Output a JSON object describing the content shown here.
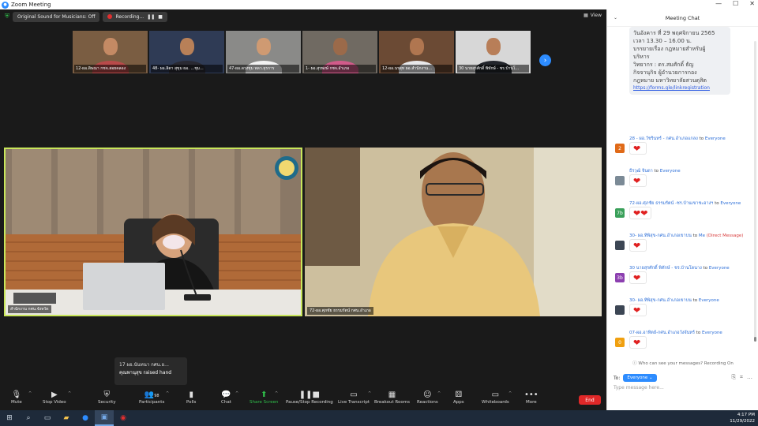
{
  "window": {
    "title": "Zoom Meeting"
  },
  "top_bar": {
    "sound_label": "Original Sound for Musicians: Off",
    "recording_label": "Recording...",
    "view_label": "View"
  },
  "thumbnails": [
    {
      "name": "12-ผอ.ดิษณา กชจ.สอยคลอง",
      "skin": "#c48a64",
      "shirt": "#b84a4a",
      "bg": "#7a5d42"
    },
    {
      "name": "48- ผอ.ลิตา สุขุม ผอ. ...ชุม...",
      "skin": "#b88058",
      "shirt": "#2a2a33",
      "bg": "#2f3b55"
    },
    {
      "name": "47-ผอ.ดวงชุม พลว.ธุรการ",
      "skin": "#cf9a72",
      "shirt": "#f2f2f2",
      "bg": "#8a8a88"
    },
    {
      "name": "1- ผอ.สุรพงษ์ กชจ.อำเภอ",
      "skin": "#9b6a4a",
      "shirt": "#d15b8a",
      "bg": "#706a62"
    },
    {
      "name": "12-ผอ.นรสุท ผอ.สำนักงาน...",
      "skin": "#b07650",
      "shirt": "#e8e8ea",
      "bg": "#6b4a34"
    },
    {
      "name": "30 นายสุรศักดิ์ พิทักษ์ - ชร.บ้านโ...",
      "skin": "#b87e58",
      "shirt": "#23262c",
      "bg": "#d7d7d7"
    }
  ],
  "main_tiles": {
    "left_name": "สำนักงาน กศน.จังหวัด",
    "right_name": "72-ผอ.ศุภชัย ธรรมรัตน์ กศน.อำเภอ"
  },
  "raised_hand": {
    "name": "17 ผอ.นันทนา กศน.อ...",
    "text": "คุณพานุสุข raised hand"
  },
  "toolbar": {
    "mute": "Mute",
    "stop_video": "Stop Video",
    "security": "Security",
    "participants": "Participants",
    "participants_count": "98",
    "polls": "Polls",
    "chat": "Chat",
    "share_screen": "Share Screen",
    "pause_recording": "Pause/Stop Recording",
    "live_transcript": "Live Transcript",
    "breakout_rooms": "Breakout Rooms",
    "reactions": "Reactions",
    "apps": "Apps",
    "whiteboards": "Whiteboards",
    "more": "More",
    "end": "End"
  },
  "chat_panel": {
    "title": "Meeting Chat",
    "pinned_text": [
      "วันอังคาร ที่ 29 พฤศจิกายน 2565",
      "เวลา 13.30 – 16.00 น.",
      "บรรยายเรื่อง กฎหมายสำหรับผู้",
      "บริหาร",
      "วิทยากร : ดร.สมศักดิ์ ธัญ",
      "กิจจานุกิจ ผู้อำนวยการกอง",
      "กฎหมาย มหาวิทยาลัยสวนดุสิต"
    ],
    "pinned_link": "https://forms.gle/linkregistration",
    "messages": [
      {
        "sender": "28 - ผอ.วัชรินทร์ - กศน.อำเภอแกลง",
        "to": "to",
        "recipient": "Everyone",
        "direct": false,
        "avatar_label": "2",
        "avatar_color": "#e06a18",
        "reaction": "❤"
      },
      {
        "sender": "ธีรวุฒิ จินดา",
        "to": "to",
        "recipient": "Everyone",
        "direct": false,
        "avatar_label": "",
        "avatar_color": "#7b8a96",
        "reaction": "❤"
      },
      {
        "sender": "72-ผอ.ศุภชัย ธรรมรัตน์ -ชร.บ้านเขาชะอางฯ",
        "to": "to",
        "recipient": "Everyone",
        "direct": false,
        "avatar_label": "7b",
        "avatar_color": "#3aa05a",
        "reaction": "❤❤"
      },
      {
        "sender": "30- ผอ.ทิพิสุข-กศน.อำเภอเขาบน",
        "to": "to",
        "recipient": "Me",
        "direct": true,
        "direct_label": "(Direct Message)",
        "avatar_label": "",
        "avatar_color": "#3c4654",
        "reaction": "❤"
      },
      {
        "sender": "30 นายสุรศักดิ์ พิทักษ์ - ชร.บ้านโดนาง",
        "to": "to",
        "recipient": "Everyone",
        "direct": false,
        "avatar_label": "3b",
        "avatar_color": "#8c3fb0",
        "reaction": "❤"
      },
      {
        "sender": "30- ผอ.ทิพิสุข-กศน.อำเภอเขาบน",
        "to": "to",
        "recipient": "Everyone",
        "direct": false,
        "avatar_label": "",
        "avatar_color": "#3c4654",
        "reaction": "❤"
      },
      {
        "sender": "07-ผอ.อาทิตย์-กศน.อำเภอวังจันทร์",
        "to": "to",
        "recipient": "Everyone",
        "direct": false,
        "avatar_label": "0",
        "avatar_color": "#f0a010",
        "reaction": "❤"
      }
    ],
    "who_can_see": "Who can see your messages? Recording On",
    "to_label": "To:",
    "to_target": "Everyone",
    "input_placeholder": "Type message here..."
  },
  "taskbar": {
    "time": "4:17 PM",
    "date": "11/29/2022"
  },
  "colors": {
    "accent": "#2d8cff",
    "speaker_border": "#c8e65a",
    "end_red": "#e02828",
    "share_green": "#2fbf4a"
  }
}
